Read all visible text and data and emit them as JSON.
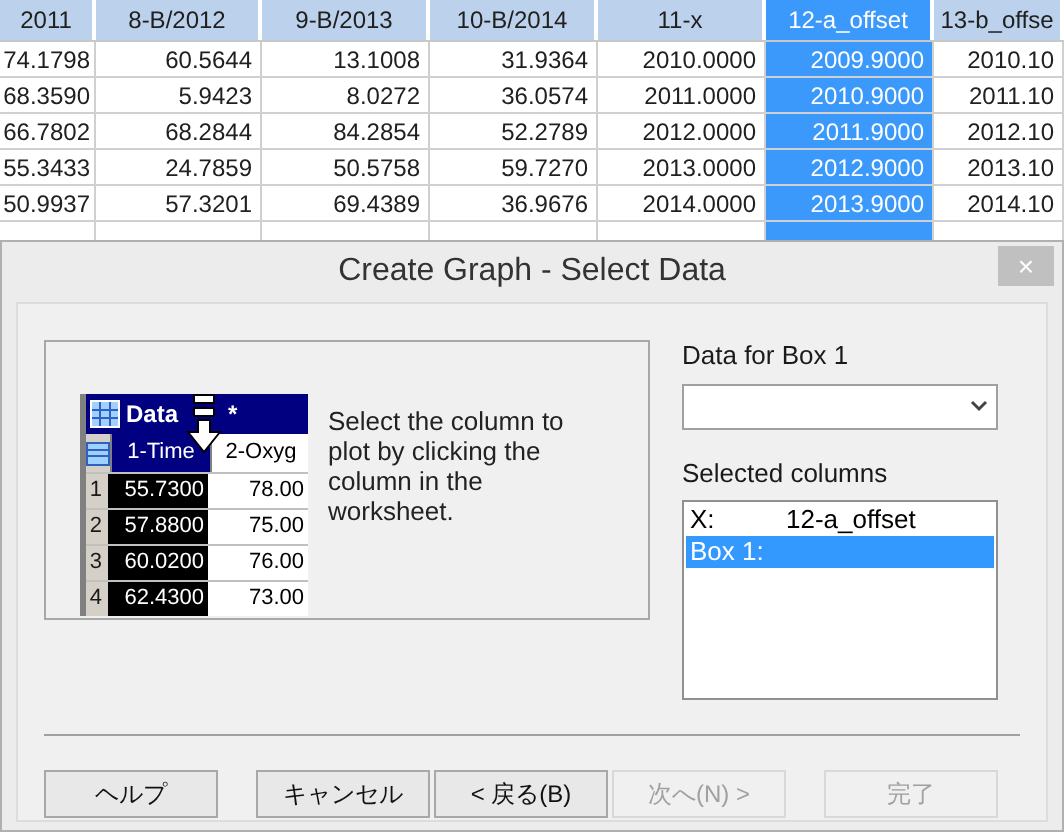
{
  "sheet": {
    "columns": [
      {
        "label": "2011",
        "selected": false
      },
      {
        "label": "8-B/2012",
        "selected": false
      },
      {
        "label": "9-B/2013",
        "selected": false
      },
      {
        "label": "10-B/2014",
        "selected": false
      },
      {
        "label": "11-x",
        "selected": false
      },
      {
        "label": "12-a_offset",
        "selected": true
      },
      {
        "label": "13-b_offse",
        "selected": false
      }
    ],
    "rows": [
      [
        "74.1798",
        "60.5644",
        "13.1008",
        "31.9364",
        "2010.0000",
        "2009.9000",
        "2010.10"
      ],
      [
        "68.3590",
        "5.9423",
        "8.0272",
        "36.0574",
        "2011.0000",
        "2010.9000",
        "2011.10"
      ],
      [
        "66.7802",
        "68.2844",
        "84.2854",
        "52.2789",
        "2012.0000",
        "2011.9000",
        "2012.10"
      ],
      [
        "55.3433",
        "24.7859",
        "50.5758",
        "59.7270",
        "2013.0000",
        "2012.9000",
        "2013.10"
      ],
      [
        "50.9937",
        "57.3201",
        "69.4389",
        "36.9676",
        "2014.0000",
        "2013.9000",
        "2014.10"
      ]
    ]
  },
  "dialog": {
    "title": "Create Graph - Select Data",
    "close": "×",
    "preview": {
      "title": "Data",
      "title_mark": "*",
      "columns": [
        {
          "label": "1-Time",
          "selected": true
        },
        {
          "label": "2-Oxyg",
          "selected": false
        }
      ],
      "rows": [
        {
          "number": "1",
          "cells": [
            "55.7300",
            "78.00"
          ]
        },
        {
          "number": "2",
          "cells": [
            "57.8800",
            "75.00"
          ]
        },
        {
          "number": "3",
          "cells": [
            "60.0200",
            "76.00"
          ]
        },
        {
          "number": "4",
          "cells": [
            "62.4300",
            "73.00"
          ]
        }
      ]
    },
    "instruction": "Select the column to plot by clicking the column in the worksheet.",
    "data_label": "Data for Box 1",
    "selected_columns_label": "Selected columns",
    "selected_columns": [
      {
        "label": "X:",
        "value": "12-a_offset",
        "selected": false
      },
      {
        "label": "Box 1:",
        "selected": true
      }
    ],
    "buttons": [
      {
        "label": "ヘルプ",
        "disabled": false
      },
      {
        "label": "キャンセル",
        "disabled": false
      },
      {
        "label": "< 戻る(B)",
        "disabled": false
      },
      {
        "label": "次へ(N) >",
        "disabled": true
      },
      {
        "label": "完了",
        "disabled": true
      }
    ]
  }
}
